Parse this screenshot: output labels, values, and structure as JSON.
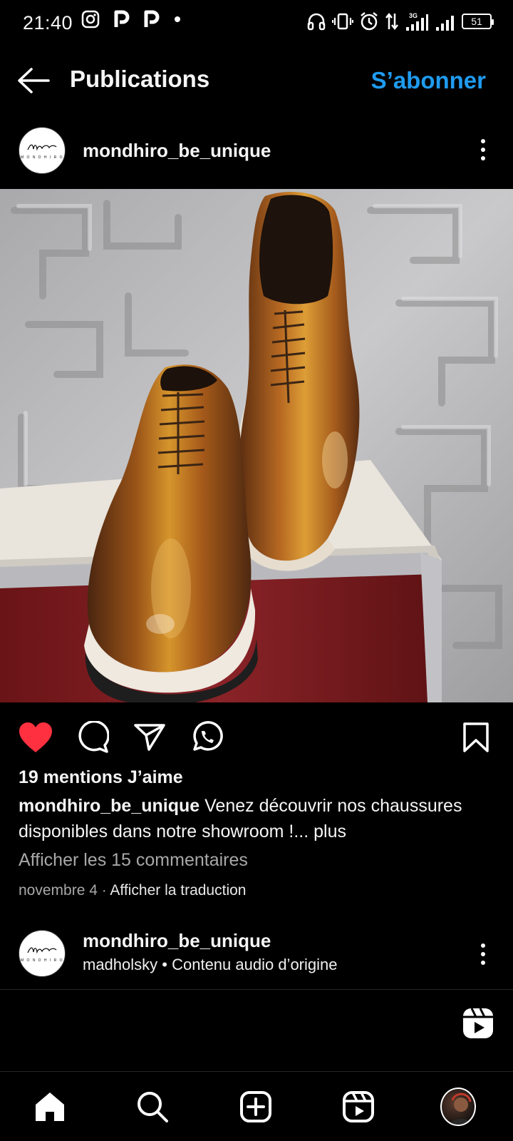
{
  "status_bar": {
    "time": "21:40",
    "left_icons": [
      "instagram-icon",
      "p-icon",
      "p-icon",
      "dot-icon"
    ],
    "network_label": "3G",
    "battery": "51"
  },
  "nav": {
    "title": "Publications",
    "follow_label": "S’abonner"
  },
  "post": {
    "username": "mondhiro_be_unique",
    "avatar_logo": "Mondhiro",
    "avatar_sub": "MONDHIRO",
    "likes": "19 mentions J’aime",
    "caption_user": "mondhiro_be_unique",
    "caption_text": " Venez découvrir nos chaussures disponibles dans notre showroom !... ",
    "caption_more": "plus",
    "comments_link": "Afficher les 15 commentaires",
    "date": "novembre 4",
    "separator": " · ",
    "translate_label": "Afficher la traduction",
    "liked": true,
    "like_color": "#ff3040"
  },
  "next_post": {
    "username": "mondhiro_be_unique",
    "audio_user": "madholsky",
    "audio_sep": " • ",
    "audio_label": "Contenu audio d’origine"
  },
  "bottom_nav": [
    "home-icon",
    "search-icon",
    "create-icon",
    "reels-icon",
    "profile-avatar"
  ],
  "colors": {
    "accent": "#1f9bf0",
    "background": "#000000",
    "secondary_text": "#a8a8a8"
  }
}
